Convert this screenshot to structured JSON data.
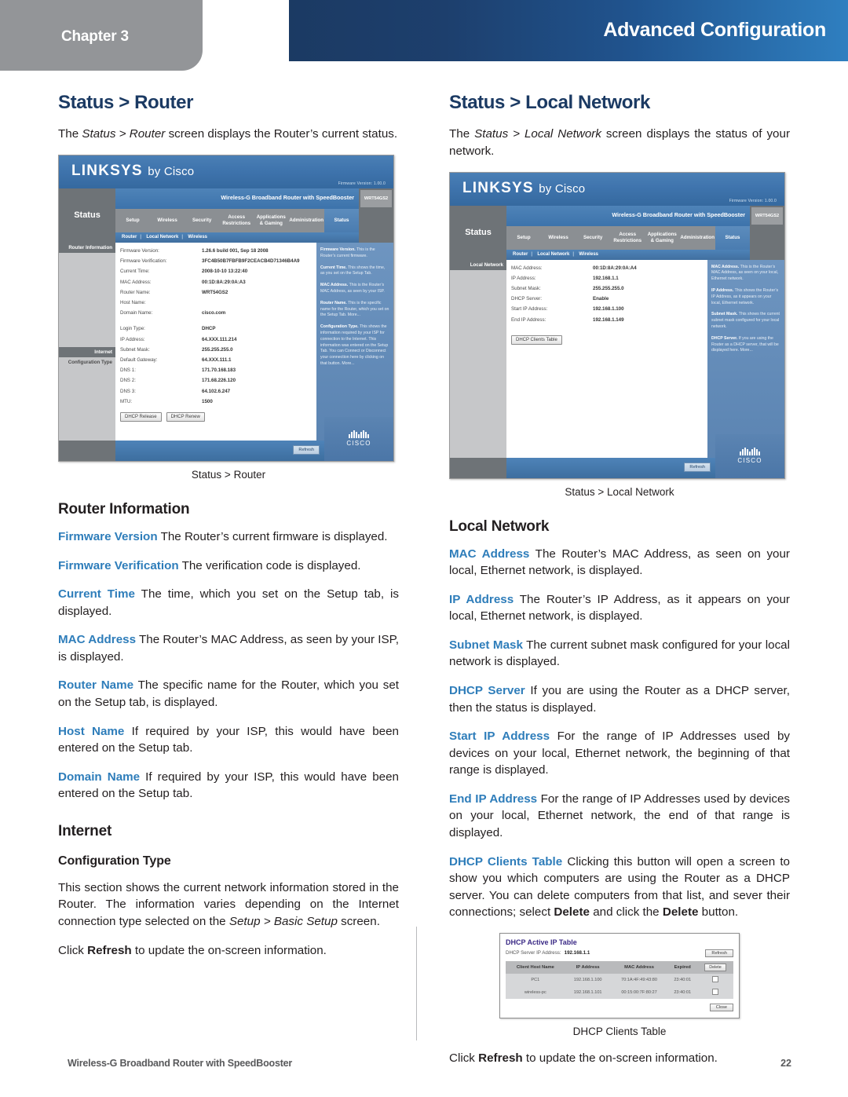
{
  "header": {
    "chapter_label": "Chapter 3",
    "title": "Advanced Configuration",
    "band_color": "#1b3a63",
    "chapter_tab_color": "#939598"
  },
  "left_column": {
    "heading": "Status > Router",
    "intro": {
      "pre": "The ",
      "italic_1": "Status > Router",
      "post": " screen displays the Router’s current status."
    },
    "screenshot_caption": "Status > Router",
    "router_information_heading": "Router Information",
    "terms": [
      {
        "term": "Firmware Version",
        "desc": " The Router’s current firmware is displayed."
      },
      {
        "term": "Firmware Verification",
        "desc": " The verification code is displayed."
      },
      {
        "term": "Current Time",
        "desc": "  The time, which you set on the Setup tab, is displayed."
      },
      {
        "term": "MAC Address",
        "desc": "  The Router’s MAC Address, as seen by your ISP, is displayed."
      },
      {
        "term": "Router Name",
        "desc": "  The specific name for the Router, which you set on the Setup tab, is displayed."
      },
      {
        "term": "Host Name",
        "desc": "  If required by your ISP, this would have been entered on the Setup tab."
      },
      {
        "term": "Domain Name",
        "desc": "  If required by your ISP, this would have been entered on the Setup tab."
      }
    ],
    "internet_heading": "Internet",
    "configuration_type_heading": "Configuration Type",
    "config_paragraph": {
      "pre": "This section shows the current network information stored in the Router. The information varies depending on the Internet connection type selected on the ",
      "italic_1": "Setup > Basic Setup",
      "post": " screen."
    },
    "refresh_paragraph": {
      "pre": "Click ",
      "bold_1": "Refresh",
      "post": " to update the on-screen information."
    }
  },
  "right_column": {
    "heading": "Status > Local Network",
    "intro": {
      "pre": "The ",
      "italic_1": "Status > Local Network",
      "post": " screen displays the status of your network."
    },
    "screenshot_caption": "Status > Local Network",
    "local_network_heading": "Local Network",
    "terms": [
      {
        "term": "MAC Address",
        "desc": "  The Router’s MAC Address, as seen on your local, Ethernet network, is displayed."
      },
      {
        "term": "IP Address",
        "desc": "  The Router’s IP Address, as it appears on your local, Ethernet network, is displayed."
      },
      {
        "term": "Subnet Mask",
        "desc": "  The current subnet mask configured for your local network is displayed."
      },
      {
        "term": "DHCP Server",
        "desc": "  If you are using the Router as a DHCP server, then the status is displayed."
      },
      {
        "term": "Start IP Address",
        "desc": "  For the range of IP Addresses used by devices on your local, Ethernet network, the beginning of that range is displayed."
      },
      {
        "term": "End IP Address",
        "desc": "  For the range of IP Addresses used by devices on your local, Ethernet network, the end of that range is displayed."
      }
    ],
    "dhcp_clients_paragraph": {
      "term": "DHCP Clients Table",
      "pre": " Clicking this button will open a screen to show you which computers are using the Router as a DHCP server. You can delete computers from that list, and sever their connections; select ",
      "bold_1": "Delete",
      "mid": " and click the ",
      "bold_2": "Delete",
      "post": " button."
    },
    "dhcp_caption": "DHCP Clients Table",
    "refresh_paragraph": {
      "pre": "Click ",
      "bold_1": "Refresh",
      "post": " to update the on-screen information."
    }
  },
  "router_ui": {
    "brand": "LINKSYS",
    "brand_suffix": "by Cisco",
    "firmware_version_note": "Firmware Version: 1.00.0",
    "product_name": "Wireless-G Broadband Router with SpeedBooster",
    "model": "WRT54GS2",
    "section_label": "Status",
    "nav_tabs": [
      "Setup",
      "Wireless",
      "Security",
      "Access Restrictions",
      "Applications & Gaming",
      "Administration",
      "Status"
    ],
    "active_nav_tab": "Status",
    "sub_nav": [
      "Router",
      "Local Network",
      "Wireless"
    ],
    "cisco_wordmark": "CISCO",
    "refresh_button": "Refresh"
  },
  "router_screen": {
    "rail_items": [
      "Router Information",
      "Internet"
    ],
    "internet_sub_label": "Configuration Type",
    "fields": [
      {
        "label": "Firmware Version:",
        "value": "1.26.6 build 001, Sep 18 2008"
      },
      {
        "label": "Firmware Verification:",
        "value": "3FC4B50B7FBFB9F2CEACB4D71346B4A9"
      },
      {
        "label": "Current Time:",
        "value": "2008-10-10 13:22:40"
      },
      {
        "label": "MAC Address:",
        "value": "00:1D:8A:29:0A:A3"
      },
      {
        "label": "Router Name:",
        "value": "WRT54GS2"
      },
      {
        "label": "Host Name:",
        "value": ""
      },
      {
        "label": "Domain Name:",
        "value": "cisco.com"
      }
    ],
    "internet_fields": [
      {
        "label": "Login Type:",
        "value": "DHCP"
      },
      {
        "label": "IP Address:",
        "value": "64.XXX.111.214"
      },
      {
        "label": "Subnet Mask:",
        "value": "255.255.255.0"
      },
      {
        "label": "Default Gateway:",
        "value": "64.XXX.111.1"
      },
      {
        "label": "DNS 1:",
        "value": "171.70.168.183"
      },
      {
        "label": "DNS 2:",
        "value": "171.68.226.120"
      },
      {
        "label": "DNS 3:",
        "value": "64.102.6.247"
      },
      {
        "label": "MTU:",
        "value": "1500"
      }
    ],
    "buttons": [
      "DHCP Release",
      "DHCP Renew"
    ],
    "help_items": [
      {
        "term": "Firmware Version.",
        "text": " This is the Router’s current firmware."
      },
      {
        "term": "Current Time.",
        "text": " This shows the time, as you set on the Setup Tab."
      },
      {
        "term": "MAC Address.",
        "text": " This is the Router’s MAC Address, as seen by your ISP."
      },
      {
        "term": "Router Name.",
        "text": " This is the specific name for the Router, which you set on the Setup Tab. More..."
      },
      {
        "term": "Configuration Type.",
        "text": " This shows the information required by your ISP for connection to the Internet. This information was entered on the Setup Tab. You can Connect or Disconnect your connection here by clicking on that button. More..."
      }
    ]
  },
  "local_network_screen": {
    "rail_items": [
      "Local Network"
    ],
    "fields": [
      {
        "label": "MAC Address:",
        "value": "00:1D:8A:29:0A:A4"
      },
      {
        "label": "IP Address:",
        "value": "192.168.1.1"
      },
      {
        "label": "Subnet Mask:",
        "value": "255.255.255.0"
      },
      {
        "label": "DHCP Server:",
        "value": "Enable"
      },
      {
        "label": "Start IP Address:",
        "value": "192.168.1.100"
      },
      {
        "label": "End IP Address:",
        "value": "192.168.1.149"
      }
    ],
    "buttons": [
      "DHCP Clients Table"
    ],
    "help_items": [
      {
        "term": "MAC Address.",
        "text": " This is the Router’s MAC Address, as seen on your local, Ethernet network."
      },
      {
        "term": "IP Address.",
        "text": " This shows the Router’s IP Address, as it appears on your local, Ethernet network."
      },
      {
        "term": "Subnet Mask.",
        "text": " This shows the current subnet mask configured for your local network."
      },
      {
        "term": "DHCP Server.",
        "text": " If you are using the Router as a DHCP server, that will be displayed here. More..."
      }
    ]
  },
  "dhcp_table": {
    "title": "DHCP Active IP Table",
    "server_ip_label": "DHCP Server IP Address:",
    "server_ip_value": "192.168.1.1",
    "refresh_button": "Refresh",
    "delete_button": "Delete",
    "close_button": "Close",
    "columns": [
      "Client Host Name",
      "IP Address",
      "MAC Address",
      "Expired"
    ],
    "rows": [
      {
        "host": "PC1",
        "ip": "192.168.1.100",
        "mac": "70:1A:4F:49:43:80",
        "expired": "23:40:01"
      },
      {
        "host": "wireless-pc",
        "ip": "192.168.1.101",
        "mac": "00:15:00:7F:80:27",
        "expired": "23:40:01"
      }
    ]
  },
  "footer": {
    "product": "Wireless-G Broadband Router with SpeedBooster",
    "page_number": "22"
  }
}
